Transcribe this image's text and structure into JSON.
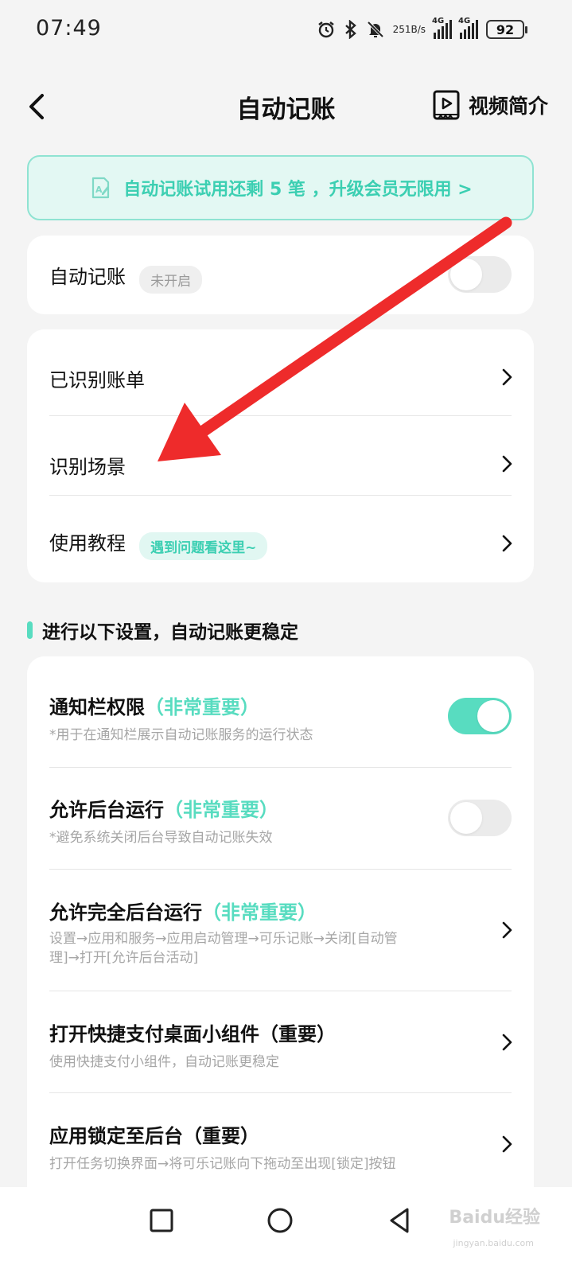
{
  "status_bar": {
    "time": "07:49",
    "net_speed_value": "251",
    "net_speed_unit": "B/s",
    "sim1_label": "4G",
    "sim2_label": "4G",
    "battery": "92",
    "icons": [
      "alarm-icon",
      "bluetooth-icon",
      "mute-bell-icon",
      "signal-icon",
      "battery-icon"
    ]
  },
  "header": {
    "title": "自动记账",
    "video_intro_label": "视频简介"
  },
  "banner": {
    "text": "自动记账试用还剩 5 笔 ，升级会员无限用 >"
  },
  "auto_record": {
    "label": "自动记账",
    "status_tag": "未开启",
    "enabled": false
  },
  "menu": {
    "items": [
      {
        "label": "已识别账单"
      },
      {
        "label": "识别场景"
      },
      {
        "label": "使用教程",
        "tag": "遇到问题看这里~"
      }
    ]
  },
  "settings_section": {
    "title": "进行以下设置，自动记账更稳定",
    "items": [
      {
        "title": "通知栏权限",
        "emphasis": "（非常重要）",
        "desc": "*用于在通知栏展示自动记账服务的运行状态",
        "control": "toggle",
        "enabled": true
      },
      {
        "title": "允许后台运行",
        "emphasis": "（非常重要）",
        "desc": "*避免系统关闭后台导致自动记账失效",
        "control": "toggle",
        "enabled": false
      },
      {
        "title": "允许完全后台运行",
        "emphasis": "（非常重要）",
        "desc_line1": "设置→应用和服务→应用启动管理→可乐记账→关闭[自动管",
        "desc_line2": "理]→打开[允许后台活动]",
        "control": "chevron"
      },
      {
        "title": "打开快捷支付桌面小组件（重要）",
        "desc": "使用快捷支付小组件，自动记账更稳定",
        "control": "chevron"
      },
      {
        "title": "应用锁定至后台（重要）",
        "desc": "打开任务切换界面→将可乐记账向下拖动至出现[锁定]按钮",
        "control": "chevron"
      }
    ]
  },
  "watermark": {
    "text": "Baidu经验",
    "sub": "jingyan.baidu.com"
  },
  "colors": {
    "accent": "#58dcc0",
    "accent_text": "#3ccfb2",
    "banner_bg": "#e3f8f3",
    "arrow": "#ee2b2b"
  }
}
